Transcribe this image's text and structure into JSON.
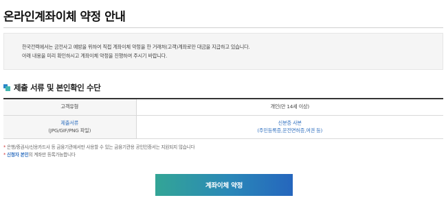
{
  "page": {
    "title": "온라인계좌이체 약정 안내"
  },
  "notice": {
    "line1": "한국전력에서는 금전사고 예방을 위하여 직접 계좌이체 약정을 한 거래처(고객)계좌로만 대금을 지급하고 있습니다.",
    "line2": "아래 내용을 미리 확인하시고 계좌이체 약정을 진행하여 주시기 바랍니다."
  },
  "section": {
    "title": "제출 서류 및 본인확인 수단",
    "icon": "blue-square-bullet-icon"
  },
  "table": {
    "row1": {
      "header": "고객유형",
      "value": "개인(만 14세 이상)"
    },
    "row2": {
      "header_line1": "제출서류",
      "header_line2": "(JPG/GIF/PNG 파일)",
      "value_line1": "신분증 사본",
      "value_line2": "(주민등록증,운전면허증,여권 등)"
    }
  },
  "notes": {
    "note1": "은행/증권사/신용카드사 등 금융기관에서만 사용할 수 있는 금융기관용 공인인증서는 지원되지 않습니다",
    "note2_highlight": "신청자 본인",
    "note2_rest": "의 계좌만 등록가능합니다",
    "marker": "*"
  },
  "button": {
    "label": "계좌이체 약정"
  },
  "colors": {
    "accent_blue": "#2f6fbf",
    "button_gradient_start": "#33a596",
    "button_gradient_end": "#2566bd",
    "note_marker": "#d03030"
  }
}
